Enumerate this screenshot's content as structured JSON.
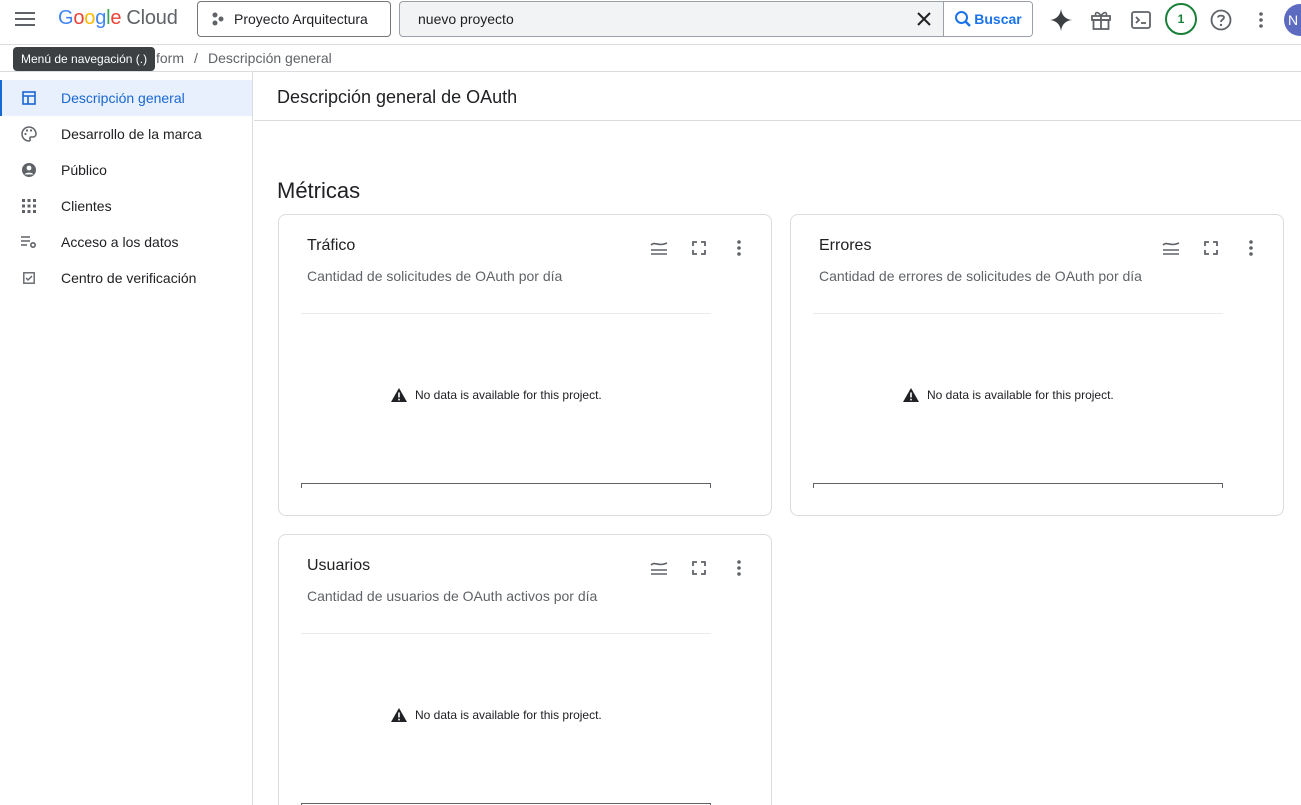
{
  "topbar": {
    "logo": {
      "g": "G",
      "o1": "o",
      "o2": "o",
      "g2": "g",
      "l": "l",
      "e": "e",
      "cloud": "Cloud"
    },
    "project": "Proyecto Arquitectura",
    "search": {
      "value": "nuevo proyecto",
      "button": "Buscar"
    },
    "notifications_count": "1",
    "avatar_initial": "N"
  },
  "tooltip": "Menú de navegación (.)",
  "breadcrumb": {
    "parent": "form",
    "separator": "/",
    "current": "Descripción general"
  },
  "sidebar": {
    "items": [
      {
        "label": "Descripción general",
        "icon": "dashboard-icon",
        "active": true
      },
      {
        "label": "Desarrollo de la marca",
        "icon": "palette-icon",
        "active": false
      },
      {
        "label": "Público",
        "icon": "account-circle-icon",
        "active": false
      },
      {
        "label": "Clientes",
        "icon": "apps-grid-icon",
        "active": false
      },
      {
        "label": "Acceso a los datos",
        "icon": "data-settings-icon",
        "active": false
      },
      {
        "label": "Centro de verificación",
        "icon": "check-box-icon",
        "active": false
      }
    ]
  },
  "main": {
    "page_title": "Descripción general de OAuth",
    "section_title": "Métricas",
    "cards": [
      {
        "title": "Tráfico",
        "subtitle": "Cantidad de solicitudes de OAuth por día",
        "empty_message": "No data is available for this project."
      },
      {
        "title": "Errores",
        "subtitle": "Cantidad de errores de solicitudes de OAuth por día",
        "empty_message": "No data is available for this project."
      },
      {
        "title": "Usuarios",
        "subtitle": "Cantidad de usuarios de OAuth activos por día",
        "empty_message": "No data is available for this project."
      }
    ]
  },
  "colors": {
    "accent": "#1967d2",
    "active_bg": "#e8f0fe",
    "success": "#188038"
  }
}
